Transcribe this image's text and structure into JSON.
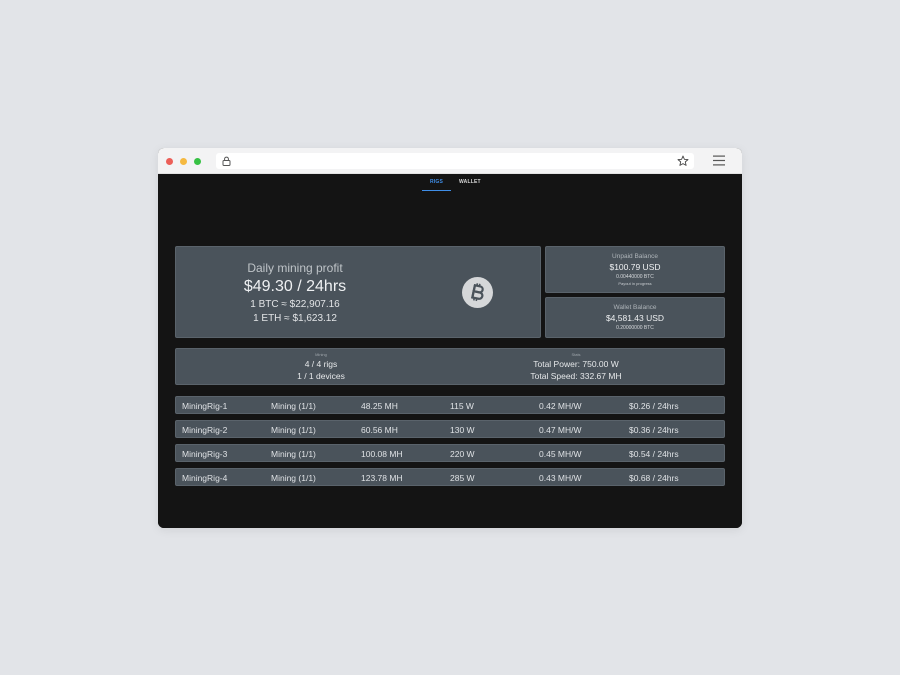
{
  "tabs": [
    {
      "label": "RIGS",
      "active": true
    },
    {
      "label": "WALLET",
      "active": false
    }
  ],
  "profit": {
    "label": "Daily mining profit",
    "amount": "$49.30 / 24hrs",
    "btc_rate": "1 BTC ≈ $22,907.16",
    "eth_rate": "1 ETH ≈ $1,623.12",
    "coin_icon": "bitcoin-icon"
  },
  "unpaid": {
    "label": "Unpaid Balance",
    "usd": "$100.79 USD",
    "btc": "0.00440000 BTC",
    "note": "Payout in progress"
  },
  "wallet": {
    "label": "Wallet Balance",
    "usd": "$4,581.43 USD",
    "btc": "0.20000000 BTC"
  },
  "summary": {
    "mining_head": "Mining",
    "rigs": "4 / 4 rigs",
    "devices": "1 / 1 devices",
    "stats_head": "Stats",
    "power": "Total Power: 750.00 W",
    "speed": "Total Speed: 332.67 MH"
  },
  "rigs": [
    {
      "name": "MiningRig-1",
      "status": "Mining (1/1)",
      "speed": "48.25 MH",
      "power": "115 W",
      "efficiency": "0.42 MH/W",
      "profit": "$0.26 / 24hrs"
    },
    {
      "name": "MiningRig-2",
      "status": "Mining (1/1)",
      "speed": "60.56 MH",
      "power": "130 W",
      "efficiency": "0.47 MH/W",
      "profit": "$0.36 / 24hrs"
    },
    {
      "name": "MiningRig-3",
      "status": "Mining (1/1)",
      "speed": "100.08 MH",
      "power": "220 W",
      "efficiency": "0.45 MH/W",
      "profit": "$0.54 / 24hrs"
    },
    {
      "name": "MiningRig-4",
      "status": "Mining (1/1)",
      "speed": "123.78 MH",
      "power": "285 W",
      "efficiency": "0.43 MH/W",
      "profit": "$0.68 / 24hrs"
    }
  ],
  "colors": {
    "accent": "#3f8ee8",
    "card": "#4a535b",
    "background": "#141414"
  }
}
